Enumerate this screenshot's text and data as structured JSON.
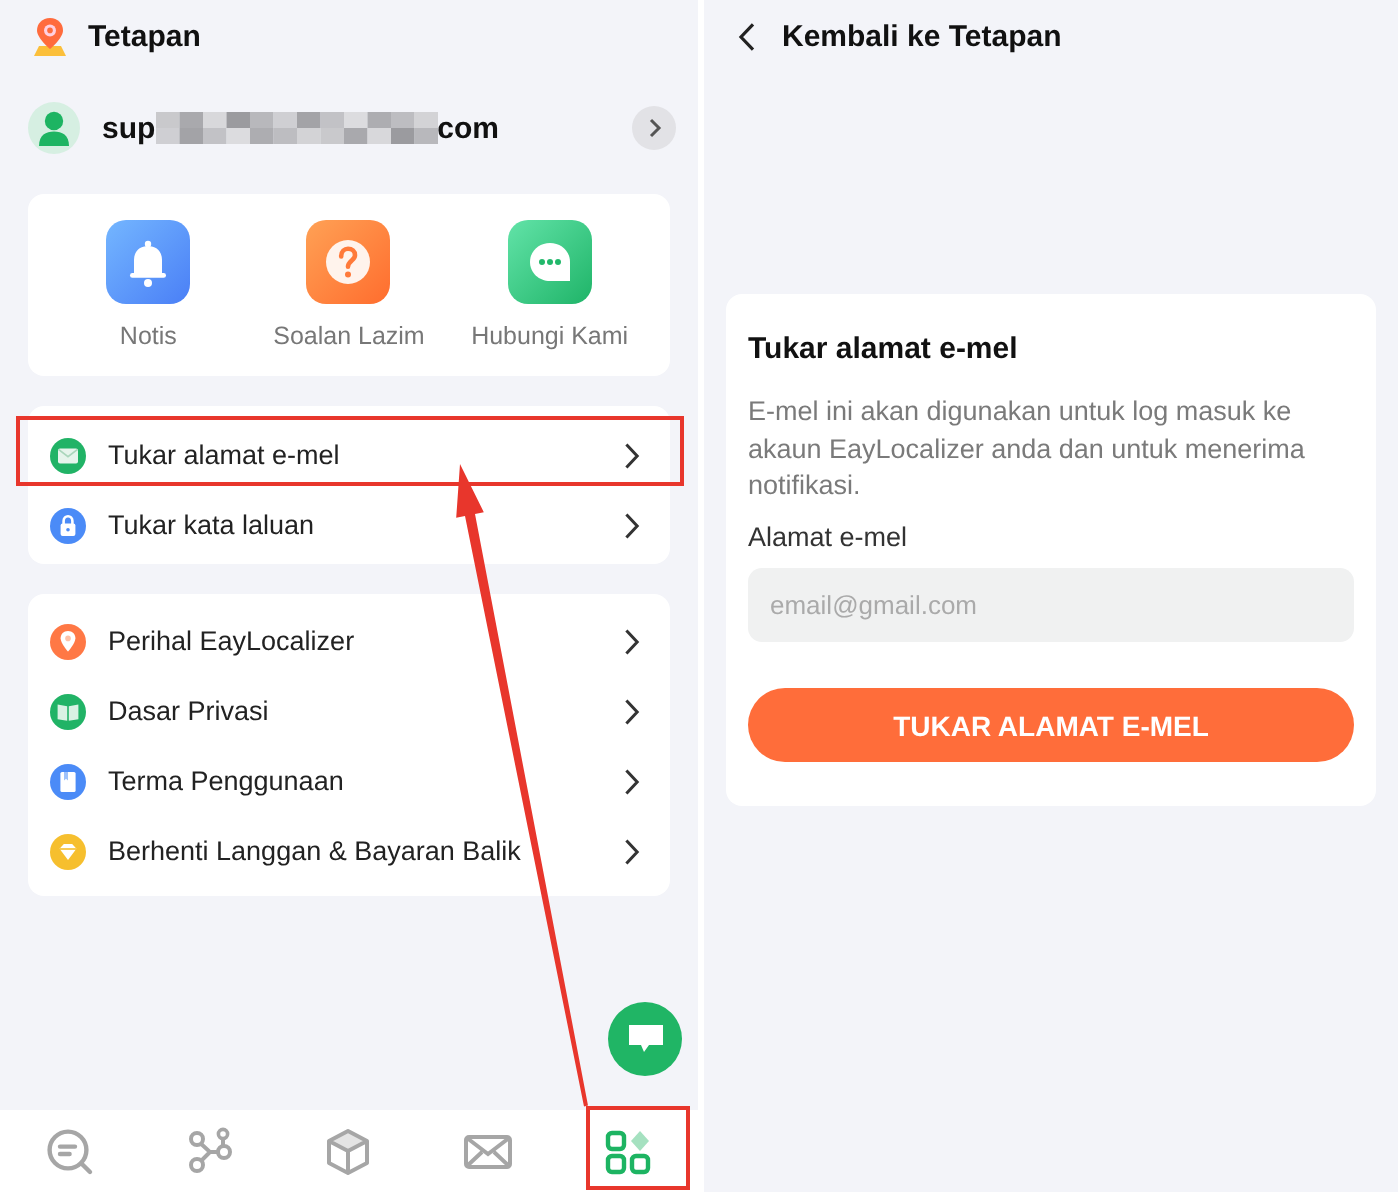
{
  "settings_panel": {
    "title": "Tetapan",
    "account": {
      "email_parts": [
        "sup",
        "com"
      ]
    },
    "quick_actions": [
      {
        "kind": "bell",
        "label": "Notis"
      },
      {
        "kind": "question",
        "label": "Soalan Lazim"
      },
      {
        "kind": "chat",
        "label": "Hubungi Kami"
      }
    ],
    "menu_groups": [
      {
        "items": [
          {
            "kind": "email",
            "label": "Tukar alamat e-mel",
            "annotated": true
          },
          {
            "kind": "lock",
            "label": "Tukar kata laluan",
            "annotated": false
          }
        ]
      },
      {
        "items": [
          {
            "kind": "pin",
            "label": "Perihal EayLocalizer",
            "annotated": false
          },
          {
            "kind": "book",
            "label": "Dasar Privasi",
            "annotated": false
          },
          {
            "kind": "document",
            "label": "Terma Penggunaan",
            "annotated": false
          },
          {
            "kind": "diamond",
            "label": "Berhenti Langgan & Bayaran Balik",
            "annotated": false
          }
        ]
      }
    ],
    "bottom_nav": [
      {
        "kind": "search",
        "selected": false,
        "annotated": false
      },
      {
        "kind": "share",
        "selected": false,
        "annotated": false
      },
      {
        "kind": "box",
        "selected": false,
        "annotated": false
      },
      {
        "kind": "mail",
        "selected": false,
        "annotated": false
      },
      {
        "kind": "apps",
        "selected": true,
        "annotated": true
      }
    ]
  },
  "change_email_panel": {
    "back_label": "Kembali ke Tetapan",
    "title": "Tukar alamat e-mel",
    "description": "E-mel ini akan digunakan untuk log masuk ke akaun EayLocalizer anda dan untuk menerima notifikasi.",
    "field_label": "Alamat e-mel",
    "email_field": {
      "placeholder": "email@gmail.com"
    },
    "submit_label": "TUKAR ALAMAT E-MEL"
  }
}
